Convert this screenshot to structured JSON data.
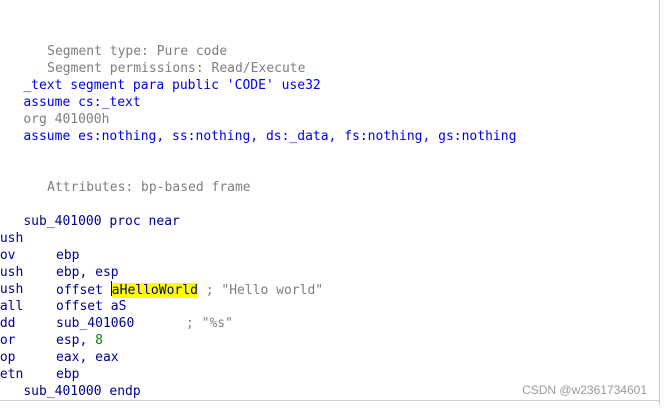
{
  "header_comments": {
    "segment_type": " Segment type: Pure code",
    "segment_permissions": " Segment permissions: Read/Execute"
  },
  "directives": {
    "segment": "_text segment para public 'CODE' use32",
    "assume_cs": "assume cs:_text",
    "org": "org 401000h",
    "assume_all": "assume es:nothing, ss:nothing, ds:_data, fs:nothing, gs:nothing"
  },
  "attributes_comment": " Attributes: bp-based frame",
  "proc_start": "sub_401000 proc near",
  "instructions": [
    {
      "mnemonic": "push",
      "operand": "ebp"
    },
    {
      "mnemonic": "mov",
      "operand": "ebp, esp"
    },
    {
      "mnemonic": "push",
      "operand_prefix": "offset ",
      "operand_highlight": "aHelloWorld",
      "comment": " ; \"Hello world\""
    },
    {
      "mnemonic": "push",
      "operand": "offset aS",
      "comment": "; \"%s\""
    },
    {
      "mnemonic": "call",
      "operand": "sub_401060"
    },
    {
      "mnemonic": "add",
      "operand_prefix": "esp, ",
      "operand_number": "8"
    },
    {
      "mnemonic": "xor",
      "operand": "eax, eax"
    },
    {
      "mnemonic": "pop",
      "operand": "ebp"
    },
    {
      "mnemonic": "retn"
    }
  ],
  "proc_end": "sub_401000 endp",
  "watermark": "CSDN @w2361734601"
}
